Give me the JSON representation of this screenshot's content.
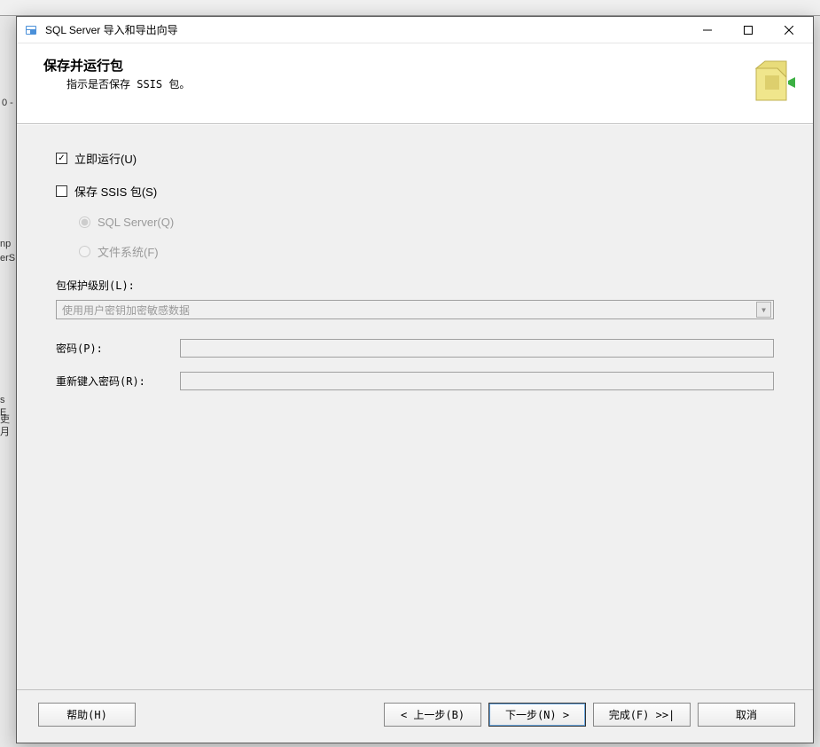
{
  "window": {
    "title": "SQL Server 导入和导出向导"
  },
  "header": {
    "title": "保存并运行包",
    "subtitle": "指示是否保存 SSIS 包。"
  },
  "options": {
    "run_now": {
      "label": "立即运行(U)",
      "checked": true
    },
    "save_ssis": {
      "label": "保存 SSIS 包(S)",
      "checked": false
    },
    "radio_sql": "SQL Server(Q)",
    "radio_file": "文件系统(F)"
  },
  "protection": {
    "label": "包保护级别(L):",
    "value": "使用用户密钥加密敏感数据"
  },
  "passwords": {
    "pw_label": "密码(P):",
    "pw_value": "",
    "repw_label": "重新键入密码(R):",
    "repw_value": ""
  },
  "buttons": {
    "help": "帮助(H)",
    "back": "< 上一步(B)",
    "next": "下一步(N) >",
    "finish": "完成(F) >>|",
    "cancel": "取消"
  },
  "bg": {
    "fragment1": "np",
    "fragment2": "erS",
    "fragment3": "s E",
    "fragment4": "吏月",
    "left_num": "0 -"
  }
}
